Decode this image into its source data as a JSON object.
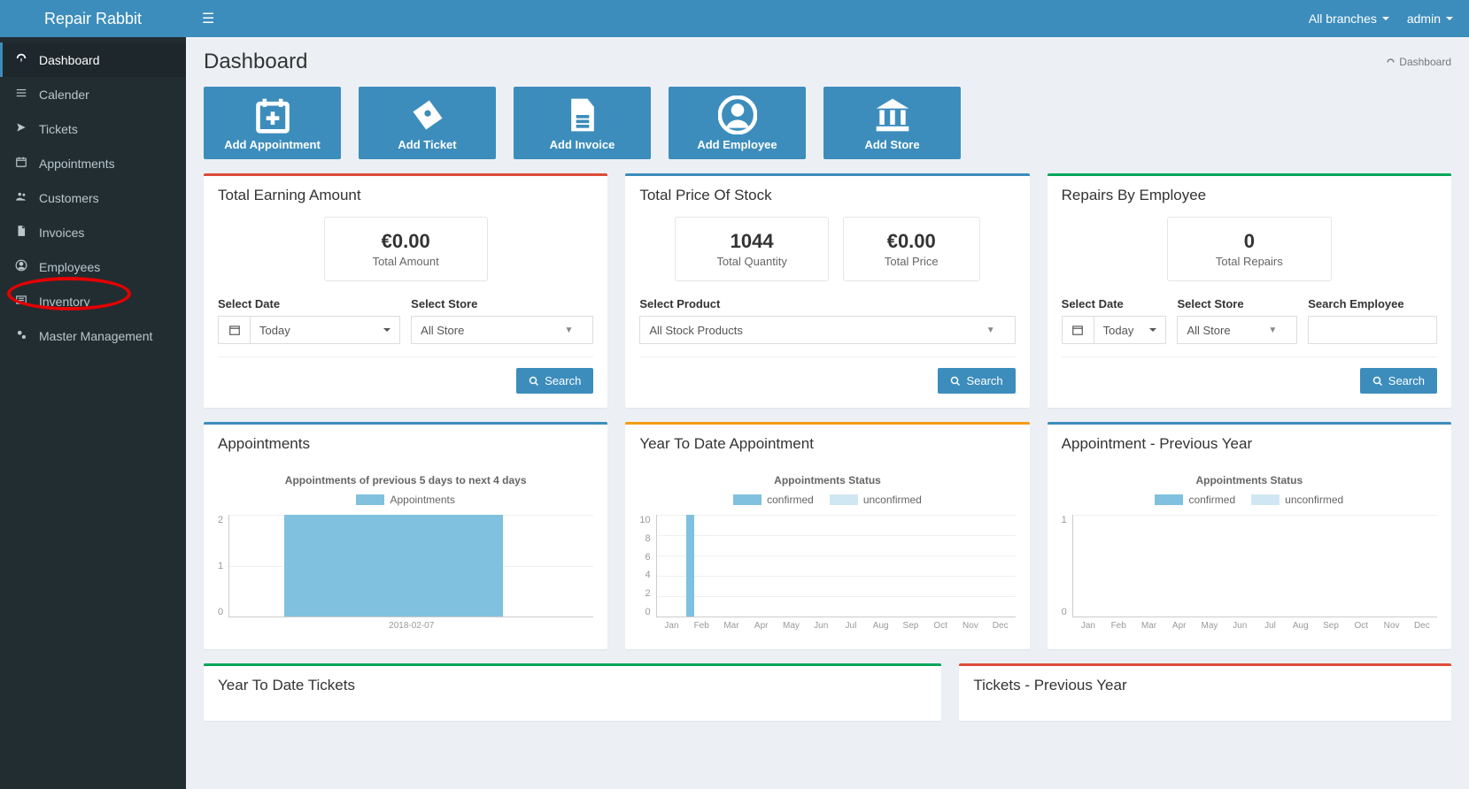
{
  "brand": "Repair Rabbit",
  "topbar": {
    "branches_label": "All branches",
    "user_label": "admin"
  },
  "sidebar": {
    "items": [
      {
        "label": "Dashboard"
      },
      {
        "label": "Calender"
      },
      {
        "label": "Tickets"
      },
      {
        "label": "Appointments"
      },
      {
        "label": "Customers"
      },
      {
        "label": "Invoices"
      },
      {
        "label": "Employees"
      },
      {
        "label": "Inventory"
      },
      {
        "label": "Master Management"
      }
    ]
  },
  "page_title": "Dashboard",
  "breadcrumb": "Dashboard",
  "action_tiles": [
    {
      "label": "Add Appointment"
    },
    {
      "label": "Add Ticket"
    },
    {
      "label": "Add Invoice"
    },
    {
      "label": "Add Employee"
    },
    {
      "label": "Add Store"
    }
  ],
  "cards": {
    "earning": {
      "title": "Total Earning Amount",
      "value": "€0.00",
      "value_label": "Total Amount",
      "date_label": "Select Date",
      "date_value": "Today",
      "store_label": "Select Store",
      "store_value": "All Store",
      "search": "Search"
    },
    "stock": {
      "title": "Total Price Of Stock",
      "qty": "1044",
      "qty_label": "Total Quantity",
      "price": "€0.00",
      "price_label": "Total Price",
      "product_label": "Select Product",
      "product_value": "All Stock Products",
      "search": "Search"
    },
    "repairs": {
      "title": "Repairs By Employee",
      "value": "0",
      "value_label": "Total Repairs",
      "date_label": "Select Date",
      "date_value": "Today",
      "store_label": "Select Store",
      "store_value": "All Store",
      "emp_label": "Search Employee",
      "search": "Search"
    },
    "appts": {
      "title": "Appointments"
    },
    "ytd_appt": {
      "title": "Year To Date Appointment"
    },
    "prev_appt": {
      "title": "Appointment - Previous Year"
    },
    "ytd_tickets": {
      "title": "Year To Date Tickets"
    },
    "prev_tickets": {
      "title": "Tickets - Previous Year"
    }
  },
  "chart_data": [
    {
      "type": "bar",
      "title": "Appointments of previous 5 days to next 4 days",
      "series": [
        {
          "name": "Appointments",
          "values": [
            2
          ]
        }
      ],
      "categories": [
        "2018-02-07"
      ],
      "ylim": [
        0,
        2
      ],
      "yticks": [
        0,
        1,
        2
      ],
      "legend": [
        "Appointments"
      ],
      "colors": {
        "Appointments": "#7fc1de"
      }
    },
    {
      "type": "bar",
      "title": "Appointments Status",
      "series": [
        {
          "name": "confirmed",
          "values": [
            0,
            10,
            0,
            0,
            0,
            0,
            0,
            0,
            0,
            0,
            0,
            0
          ]
        },
        {
          "name": "unconfirmed",
          "values": [
            0,
            0,
            0,
            0,
            0,
            0,
            0,
            0,
            0,
            0,
            0,
            0
          ]
        }
      ],
      "categories": [
        "Jan",
        "Feb",
        "Mar",
        "Apr",
        "May",
        "Jun",
        "Jul",
        "Aug",
        "Sep",
        "Oct",
        "Nov",
        "Dec"
      ],
      "ylim": [
        0,
        10
      ],
      "yticks": [
        0,
        2,
        4,
        6,
        8,
        10
      ],
      "legend": [
        "confirmed",
        "unconfirmed"
      ],
      "colors": {
        "confirmed": "#7fc1de",
        "unconfirmed": "#cfe7f3"
      }
    },
    {
      "type": "bar",
      "title": "Appointments Status",
      "series": [
        {
          "name": "confirmed",
          "values": [
            0,
            0,
            0,
            0,
            0,
            0,
            0,
            0,
            0,
            0,
            0,
            0
          ]
        },
        {
          "name": "unconfirmed",
          "values": [
            0,
            0,
            0,
            0,
            0,
            0,
            0,
            0,
            0,
            0,
            0,
            0
          ]
        }
      ],
      "categories": [
        "Jan",
        "Feb",
        "Mar",
        "Apr",
        "May",
        "Jun",
        "Jul",
        "Aug",
        "Sep",
        "Oct",
        "Nov",
        "Dec"
      ],
      "ylim": [
        0,
        1
      ],
      "yticks": [
        0,
        1
      ],
      "legend": [
        "confirmed",
        "unconfirmed"
      ],
      "colors": {
        "confirmed": "#7fc1de",
        "unconfirmed": "#cfe7f3"
      }
    }
  ]
}
